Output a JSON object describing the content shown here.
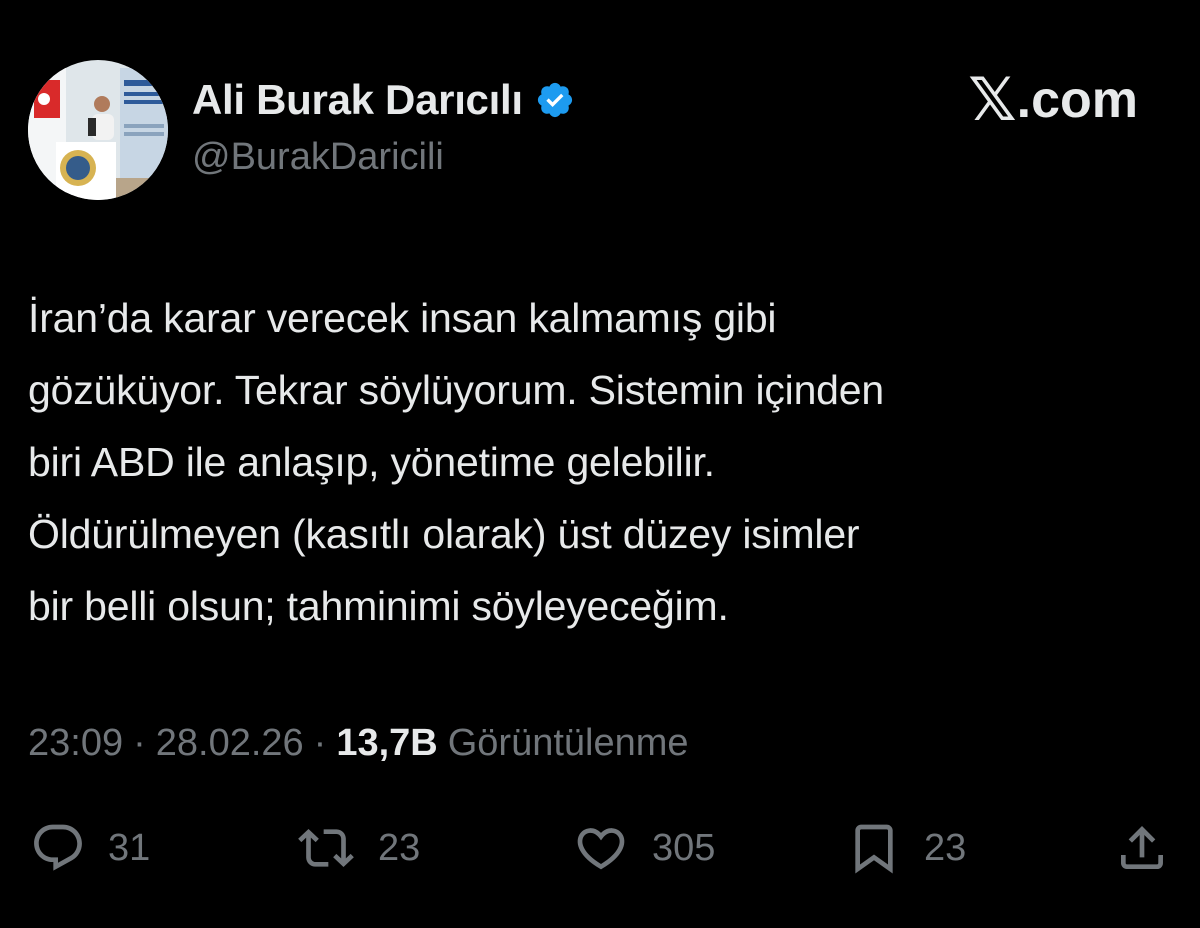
{
  "author": {
    "display_name": "Ali Burak Darıcılı",
    "handle": "@BurakDaricili",
    "verified": true,
    "verified_color": "#1d9bf0"
  },
  "brand": {
    "x_glyph": "𝕏",
    "domain": ".com"
  },
  "tweet": {
    "lines": [
      "İran’da karar verecek insan kalmamış gibi",
      "gözüküyor. Tekrar söylüyorum. Sistemin içinden",
      "biri ABD ile anlaşıp, yönetime gelebilir.",
      "Öldürülmeyen (kasıtlı olarak) üst düzey isimler",
      "bir belli olsun; tahminimi söyleyeceğim."
    ]
  },
  "meta": {
    "time": "23:09",
    "separator": "·",
    "date": "28.02.26",
    "views_count": "13,7B",
    "views_label": "Görüntülenme"
  },
  "actions": {
    "reply_count": "31",
    "retweet_count": "23",
    "like_count": "305",
    "bookmark_count": "23"
  },
  "icons": {
    "reply": "reply-icon",
    "retweet": "retweet-icon",
    "like": "heart-icon",
    "bookmark": "bookmark-icon",
    "share": "share-icon",
    "verified": "verified-badge-icon"
  },
  "colors": {
    "background": "#000000",
    "primary_text": "#e7e9ea",
    "secondary_text": "#71767b",
    "accent": "#1d9bf0"
  }
}
